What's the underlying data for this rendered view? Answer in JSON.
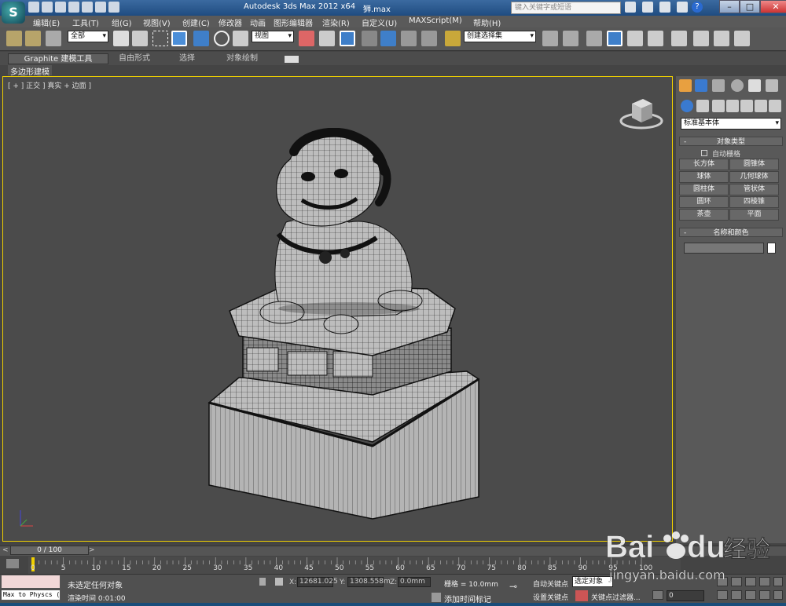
{
  "title_bar": {
    "app_title": "Autodesk 3ds Max  2012 x64",
    "file_name": "狮.max",
    "search_placeholder": "键入关键字或短语",
    "win_min": "–",
    "win_max": "□",
    "win_close": "✕",
    "help": "?"
  },
  "menu": {
    "items": [
      "编辑(E)",
      "工具(T)",
      "组(G)",
      "视图(V)",
      "创建(C)",
      "修改器",
      "动画",
      "图形编辑器",
      "渲染(R)",
      "自定义(U)",
      "MAXScript(M)",
      "帮助(H)"
    ]
  },
  "toolbar": {
    "selection_filter": "全部",
    "reference_coord": "视图",
    "named_selection": "创建选择集"
  },
  "ribbon": {
    "tabs": [
      "Graphite 建模工具",
      "自由形式",
      "选择",
      "对象绘制"
    ],
    "sub_tab": "多边形建模"
  },
  "viewport": {
    "label": "[ + ] 正交 ] 真实 + 边面 ]"
  },
  "command_panel": {
    "category": "标准基本体",
    "object_type_title": "对象类型",
    "autogrid_label": "自动栅格",
    "buttons": [
      "长方体",
      "圆锥体",
      "球体",
      "几何球体",
      "圆柱体",
      "管状体",
      "圆环",
      "四棱锥",
      "茶壶",
      "平面"
    ],
    "name_color_title": "名称和颜色",
    "rollout_minus": "-"
  },
  "time_slider": {
    "position": "0 / 100",
    "prev": "<",
    "next": ">",
    "ticks": [
      "0",
      "5",
      "10",
      "15",
      "20",
      "25",
      "30",
      "35",
      "40",
      "45",
      "50",
      "55",
      "60",
      "65",
      "70",
      "75",
      "80",
      "85",
      "90",
      "95",
      "100"
    ]
  },
  "status": {
    "maxscript_output": "Max to Physcs (",
    "prompt": "未选定任何对象",
    "render_time": "渲染时间  0:01:00",
    "x_label": "X:",
    "x_value": "12681.025",
    "y_label": "Y:",
    "y_value": "1308.558m",
    "z_label": "Z:",
    "z_value": "0.0mm",
    "grid": "栅格 = 10.0mm",
    "add_time_tag": "添加时间标记",
    "auto_key": "自动关键点",
    "set_key": "设置关键点",
    "selected_dropdown": "选定对象",
    "key_filters": "关键点过滤器...",
    "current_frame": "0"
  },
  "watermark": {
    "brand": "Bai",
    "brand2": "du",
    "chinese": "经验",
    "url": "jingyan.baidu.com"
  }
}
